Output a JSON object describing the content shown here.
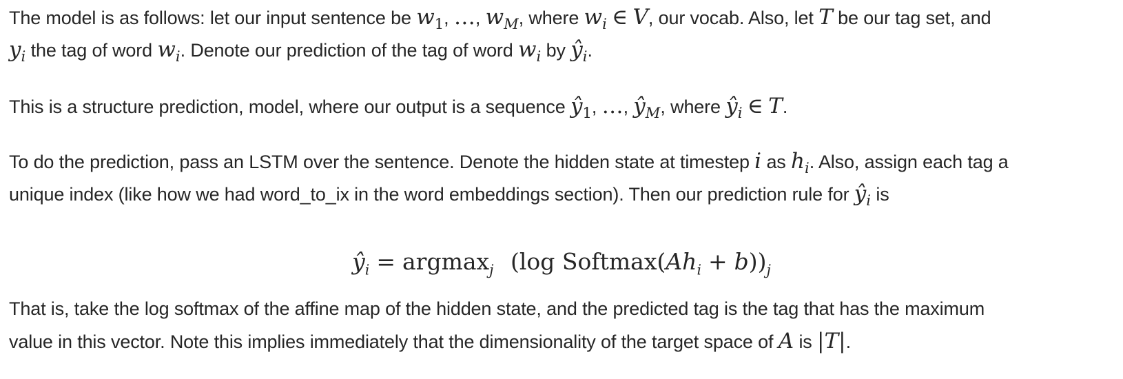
{
  "paragraphs": [
    {
      "lines": [
        "The model is as follows: let our input sentence be w₁, …, w_M, where wᵢ ∈ V, our vocab. Also, let T be our tag set, and",
        "yᵢ the tag of word wᵢ. Denote our prediction of the tag of word wᵢ by ŷᵢ."
      ]
    },
    {
      "lines": [
        "This is a structure prediction, model, where our output is a sequence ŷ₁, …, ŷ_M, where ŷᵢ ∈ T."
      ]
    },
    {
      "lines": [
        "To do the prediction, pass an LSTM over the sentence. Denote the hidden state at timestep i as hᵢ. Also, assign each tag a",
        "unique index (like how we had word_to_ix in the word embeddings section). Then our prediction rule for ŷᵢ is"
      ]
    },
    {
      "lines": [
        "That is, take the log softmax of the affine map of the hidden state, and the predicted tag is the tag that has the maximum",
        "value in this vector. Note this implies immediately that the dimensionality of the target space of A is |T|."
      ]
    }
  ],
  "equation": "ŷᵢ = argmaxⱼ (log Softmax(Ahᵢ + b))ⱼ"
}
